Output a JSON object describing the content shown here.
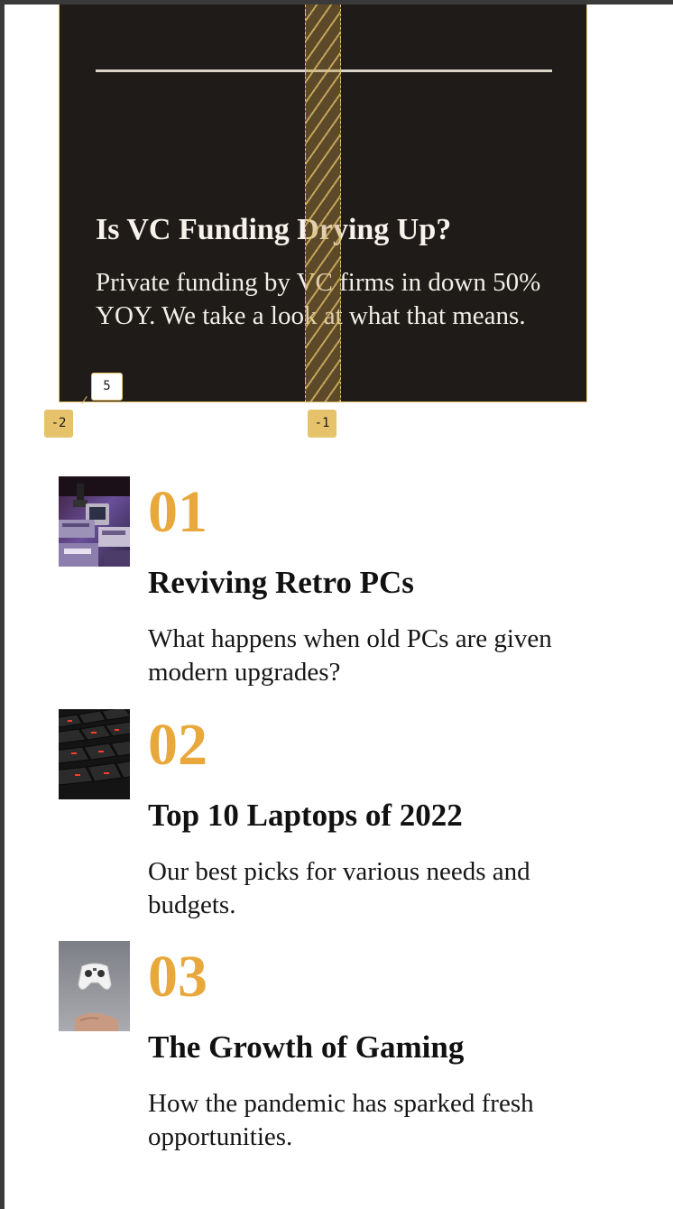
{
  "feature": {
    "title": "Is VC Funding Drying Up?",
    "text": "Private funding by VC firms in down 50% YOY. We take a look at what that means."
  },
  "overlay": {
    "badge_left": "-2",
    "badge_column": "-1",
    "badge_count": "5"
  },
  "articles": [
    {
      "number": "01",
      "title": "Reviving Retro PCs",
      "description": "What happens when old PCs are given modern upgrades?",
      "thumbnail": "retro-pc-photo"
    },
    {
      "number": "02",
      "title": "Top 10 Laptops of 2022",
      "description": "Our best picks for various needs and budgets.",
      "thumbnail": "laptop-keyboard-photo"
    },
    {
      "number": "03",
      "title": "The Growth of Gaming",
      "description": "How the pandemic has sparked fresh opportunities.",
      "thumbnail": "game-controller-photo"
    }
  ],
  "colors": {
    "accent": "#e8a83c",
    "card_background": "#1f1b18",
    "overlay": "#e6c26a"
  }
}
